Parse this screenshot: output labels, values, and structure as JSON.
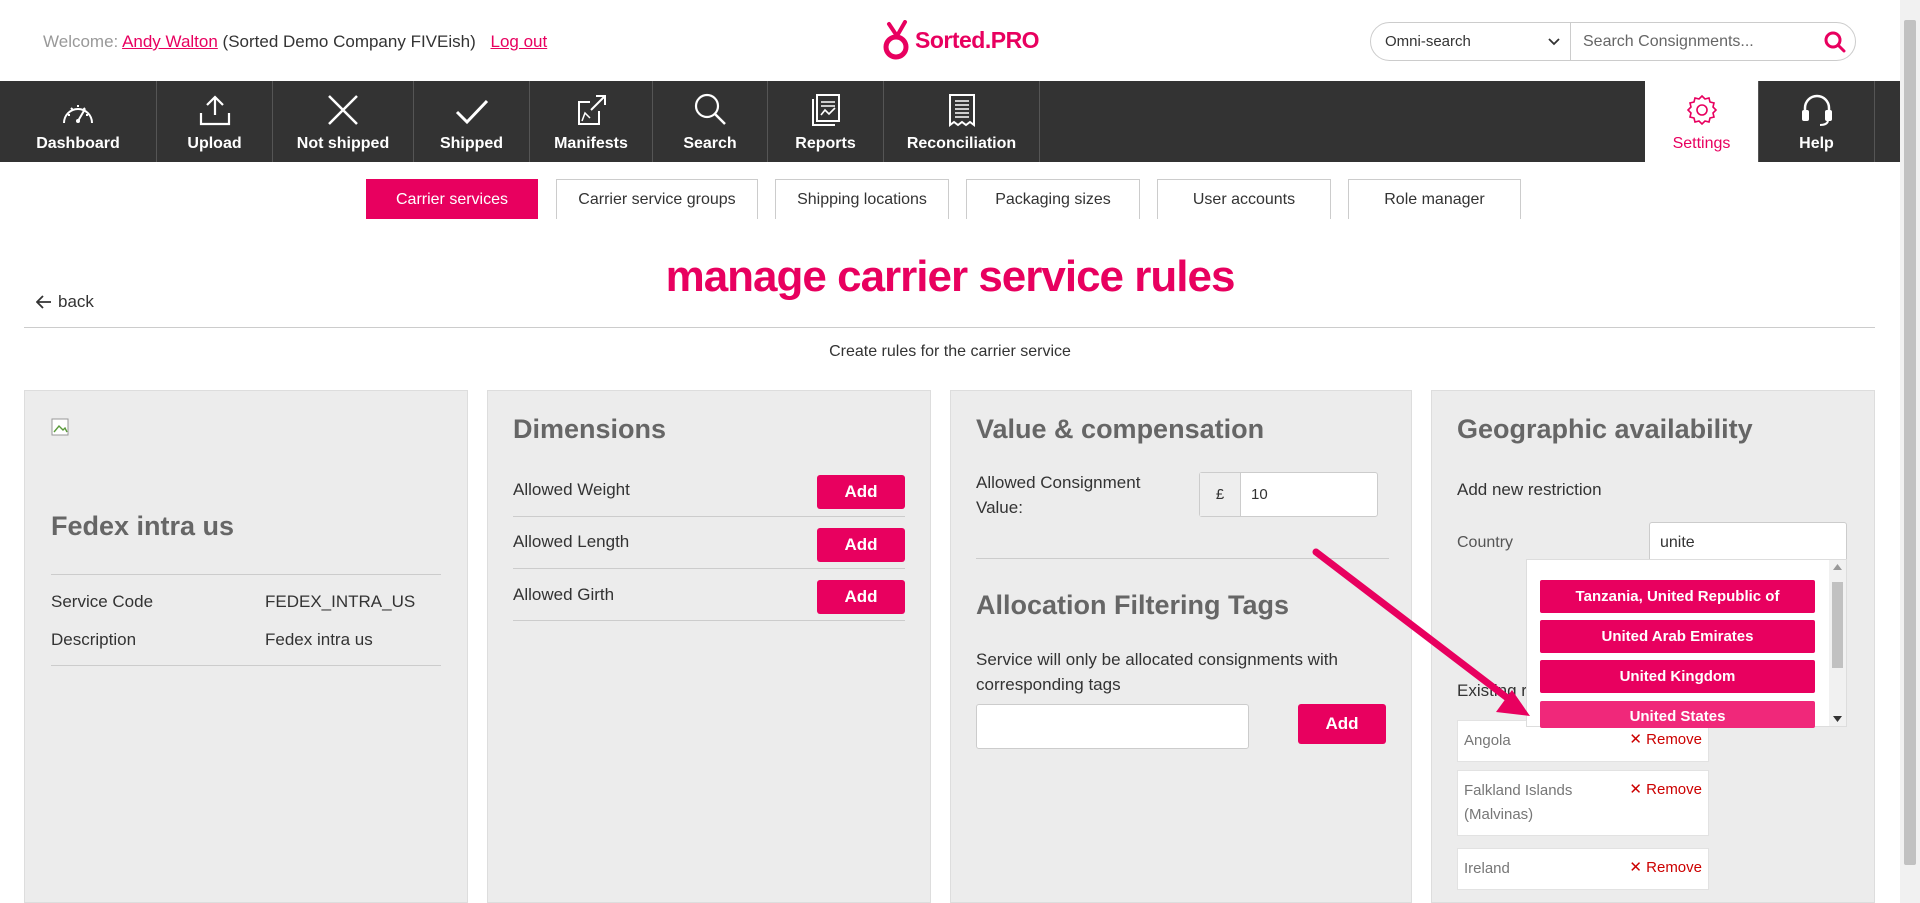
{
  "header": {
    "welcome_prefix": "Welcome:",
    "user_name": "Andy Walton",
    "company": "(Sorted Demo Company FIVEish)",
    "logout": "Log out",
    "logo_text": "Sorted.PRO",
    "omni_label": "Omni-search",
    "search_placeholder": "Search Consignments..."
  },
  "nav": {
    "items": [
      {
        "label": "Dashboard",
        "icon": "dashboard-icon"
      },
      {
        "label": "Upload",
        "icon": "upload-icon"
      },
      {
        "label": "Not shipped",
        "icon": "x-icon"
      },
      {
        "label": "Shipped",
        "icon": "check-icon"
      },
      {
        "label": "Manifests",
        "icon": "manifest-icon"
      },
      {
        "label": "Search",
        "icon": "search-icon"
      },
      {
        "label": "Reports",
        "icon": "reports-icon"
      },
      {
        "label": "Reconciliation",
        "icon": "receipt-icon"
      }
    ],
    "settings": "Settings",
    "help": "Help"
  },
  "subtabs": [
    "Carrier services",
    "Carrier service groups",
    "Shipping locations",
    "Packaging sizes",
    "User accounts",
    "Role manager"
  ],
  "page": {
    "back": "back",
    "title": "manage carrier service rules",
    "subtitle": "Create rules for the carrier service"
  },
  "service": {
    "name": "Fedex intra us",
    "code_label": "Service Code",
    "code_value": "FEDEX_INTRA_US",
    "desc_label": "Description",
    "desc_value": "Fedex intra us"
  },
  "dimensions": {
    "title": "Dimensions",
    "rows": [
      "Allowed Weight",
      "Allowed Length",
      "Allowed Girth"
    ],
    "add": "Add"
  },
  "value": {
    "title": "Value & compensation",
    "label_line1": "Allowed Consignment",
    "label_line2": "Value:",
    "currency": "£",
    "amount": "10"
  },
  "tags": {
    "title": "Allocation Filtering Tags",
    "desc_line1": "Service will only be allocated consignments with",
    "desc_line2": "corresponding tags",
    "add": "Add"
  },
  "geo": {
    "title": "Geographic availability",
    "add_new": "Add new restriction",
    "country_label": "Country",
    "country_value": "unite",
    "existing_label": "Existing r",
    "suggestions": [
      "Tanzania, United Republic of",
      "United Arab Emirates",
      "United Kingdom",
      "United States"
    ],
    "restrictions": [
      {
        "line1": "Angola",
        "line2": ""
      },
      {
        "line1": "Falkland Islands",
        "line2": "(Malvinas)"
      },
      {
        "line1": "Ireland",
        "line2": ""
      }
    ],
    "remove": "Remove"
  },
  "colors": {
    "accent": "#e8005f",
    "nav_bg": "#333333"
  }
}
